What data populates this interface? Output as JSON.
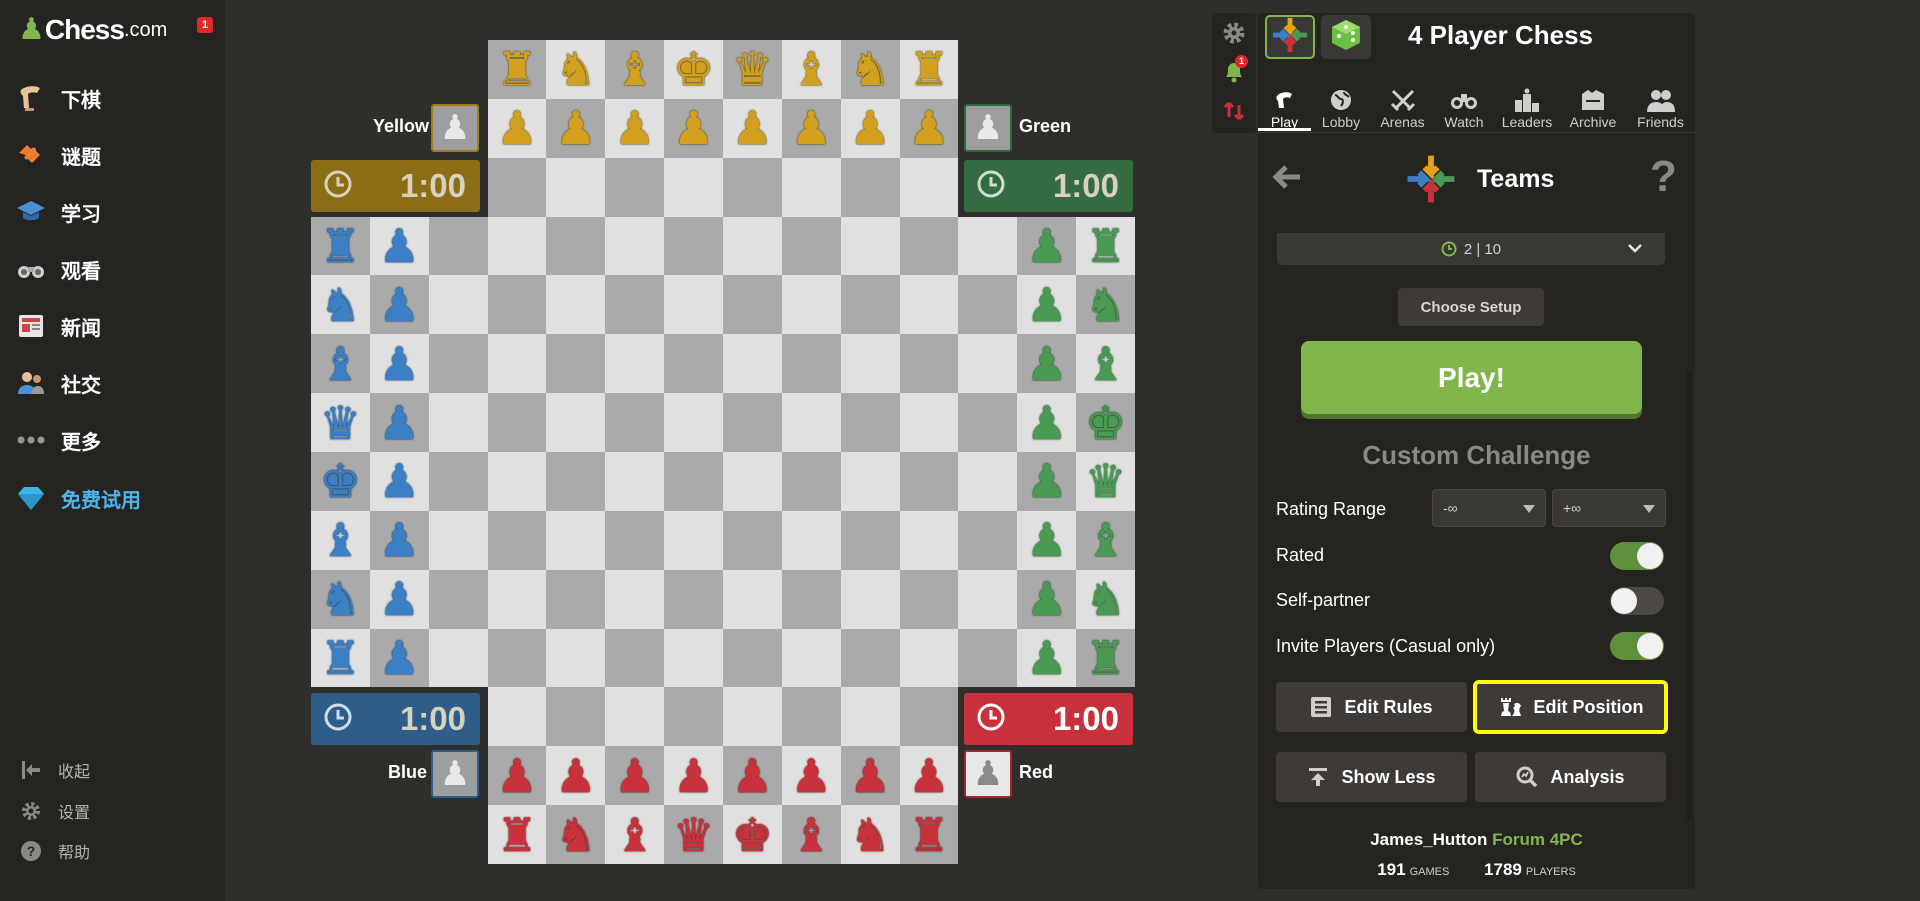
{
  "sidebar": {
    "brand": "Chess",
    "brand_tld": ".com",
    "notification_count": "1",
    "items": [
      {
        "label": "下棋",
        "icon": "play-hand-icon"
      },
      {
        "label": "谜题",
        "icon": "puzzle-icon"
      },
      {
        "label": "学习",
        "icon": "graduation-cap-icon"
      },
      {
        "label": "观看",
        "icon": "binoculars-icon"
      },
      {
        "label": "新闻",
        "icon": "news-icon"
      },
      {
        "label": "社交",
        "icon": "people-icon"
      },
      {
        "label": "更多",
        "icon": "more-dots-icon"
      },
      {
        "label": "免费试用",
        "icon": "diamond-icon"
      }
    ],
    "footer": [
      {
        "label": "收起",
        "icon": "collapse-icon"
      },
      {
        "label": "设置",
        "icon": "settings-gear-icon"
      },
      {
        "label": "帮助",
        "icon": "help-icon"
      }
    ]
  },
  "players": {
    "yellow": {
      "name": "Yellow",
      "time": "1:00"
    },
    "green": {
      "name": "Green",
      "time": "1:00"
    },
    "blue": {
      "name": "Blue",
      "time": "1:00"
    },
    "red": {
      "name": "Red",
      "time": "1:00"
    }
  },
  "board": {
    "yellow_back": [
      "♜",
      "♞",
      "♝",
      "♚",
      "♛",
      "♝",
      "♞",
      "♜"
    ],
    "red_back": [
      "♜",
      "♞",
      "♝",
      "♛",
      "♚",
      "♝",
      "♞",
      "♜"
    ],
    "blue_back": [
      "♜",
      "♞",
      "♝",
      "♛",
      "♚",
      "♝",
      "♞",
      "♜"
    ],
    "green_back": [
      "♜",
      "♞",
      "♝",
      "♚",
      "♛",
      "♝",
      "♞",
      "♜"
    ],
    "pawn": "♟",
    "colors": {
      "light": "#e0e0e0",
      "dark": "#aaaaaa",
      "yellow": "#d1a01f",
      "blue": "#3c7fc4",
      "green": "#4a9a54",
      "red": "#c9323b"
    }
  },
  "panel": {
    "title": "4 Player Chess",
    "side_notification_count": "1",
    "tabs": [
      {
        "label": "Play",
        "icon": "play-pawn-icon"
      },
      {
        "label": "Lobby",
        "icon": "globe-icon"
      },
      {
        "label": "Arenas",
        "icon": "crossed-swords-icon"
      },
      {
        "label": "Watch",
        "icon": "binoculars-icon"
      },
      {
        "label": "Leaders",
        "icon": "podium-icon"
      },
      {
        "label": "Archive",
        "icon": "archive-icon"
      },
      {
        "label": "Friends",
        "icon": "friends-icon"
      }
    ],
    "mode": "Teams",
    "help": "?",
    "time_control": "2 | 10",
    "choose_setup": "Choose Setup",
    "play": "Play!",
    "custom_challenge": "Custom Challenge",
    "rating_range_label": "Rating Range",
    "rating_min": "-∞",
    "rating_max": "+∞",
    "rated_label": "Rated",
    "rated": true,
    "self_partner_label": "Self-partner",
    "self_partner": false,
    "invite_label": "Invite Players (Casual only)",
    "invite": true,
    "edit_rules": "Edit Rules",
    "edit_position": "Edit Position",
    "show_less": "Show Less",
    "analysis": "Analysis",
    "footer_user": "James_Hutton",
    "footer_forum": "Forum 4PC",
    "games_count": "191",
    "games_label": "GAMES",
    "players_count": "1789",
    "players_label": "PLAYERS"
  }
}
